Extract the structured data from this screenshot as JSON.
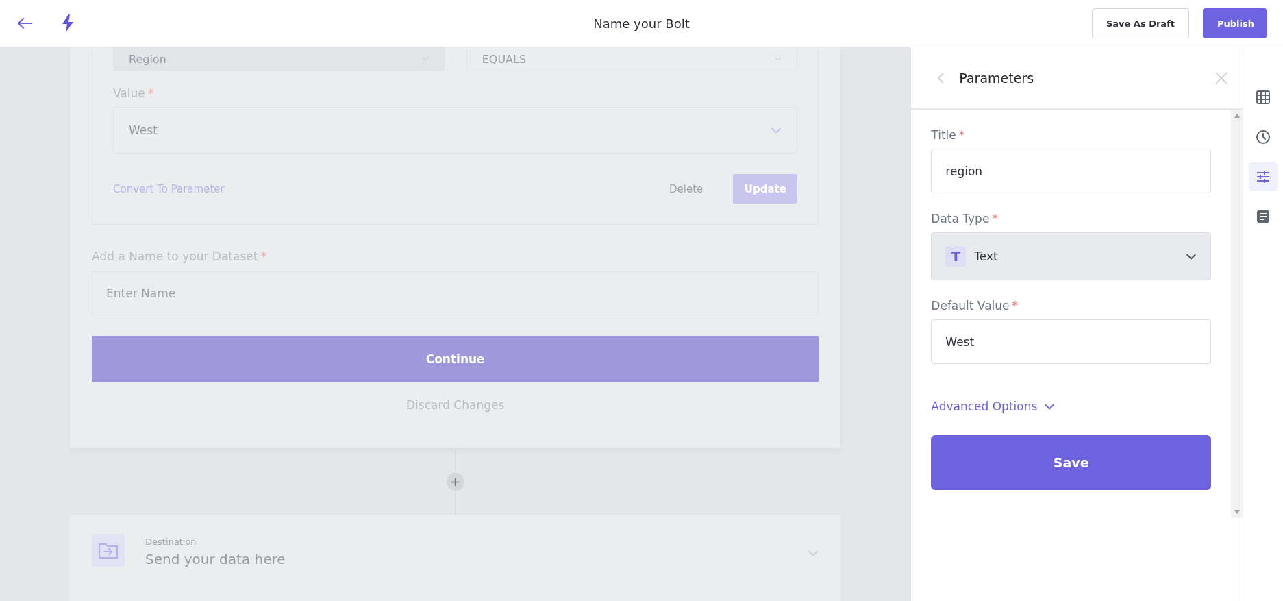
{
  "header": {
    "title": "Name your Bolt",
    "buttons": [
      {
        "label": "Save As Draft",
        "kind": "secondary"
      },
      {
        "label": "Publish",
        "kind": "primary"
      }
    ]
  },
  "filter": {
    "field": "Region",
    "operator": "EQUALS",
    "value_label": "Value",
    "value_mark": "*",
    "value": "West",
    "convert_link": "Convert To Parameter",
    "delete": "Delete",
    "update": "Update"
  },
  "dataset": {
    "label": "Add a Name to your Dataset",
    "mark": "*",
    "placeholder": "Enter Name",
    "continue": "Continue",
    "discard": "Discard Changes"
  },
  "add_step": "+",
  "destination": {
    "caption": "Destination",
    "title": "Send your data here"
  },
  "panel": {
    "title": "Parameters",
    "fields": [
      {
        "label": "Title",
        "mark": "*",
        "kind": "input",
        "value": "region"
      },
      {
        "label": "Data Type",
        "mark": "*",
        "kind": "select",
        "value": "Text",
        "badge": "T"
      },
      {
        "label": "Default Value",
        "mark": "*",
        "kind": "input",
        "value": "West"
      }
    ],
    "advanced": "Advanced Options",
    "save": "Save"
  },
  "rail": [
    {
      "kind": "grid",
      "selected": false
    },
    {
      "kind": "clock",
      "selected": false
    },
    {
      "kind": "sliders",
      "selected": true
    },
    {
      "kind": "document",
      "selected": false
    }
  ]
}
